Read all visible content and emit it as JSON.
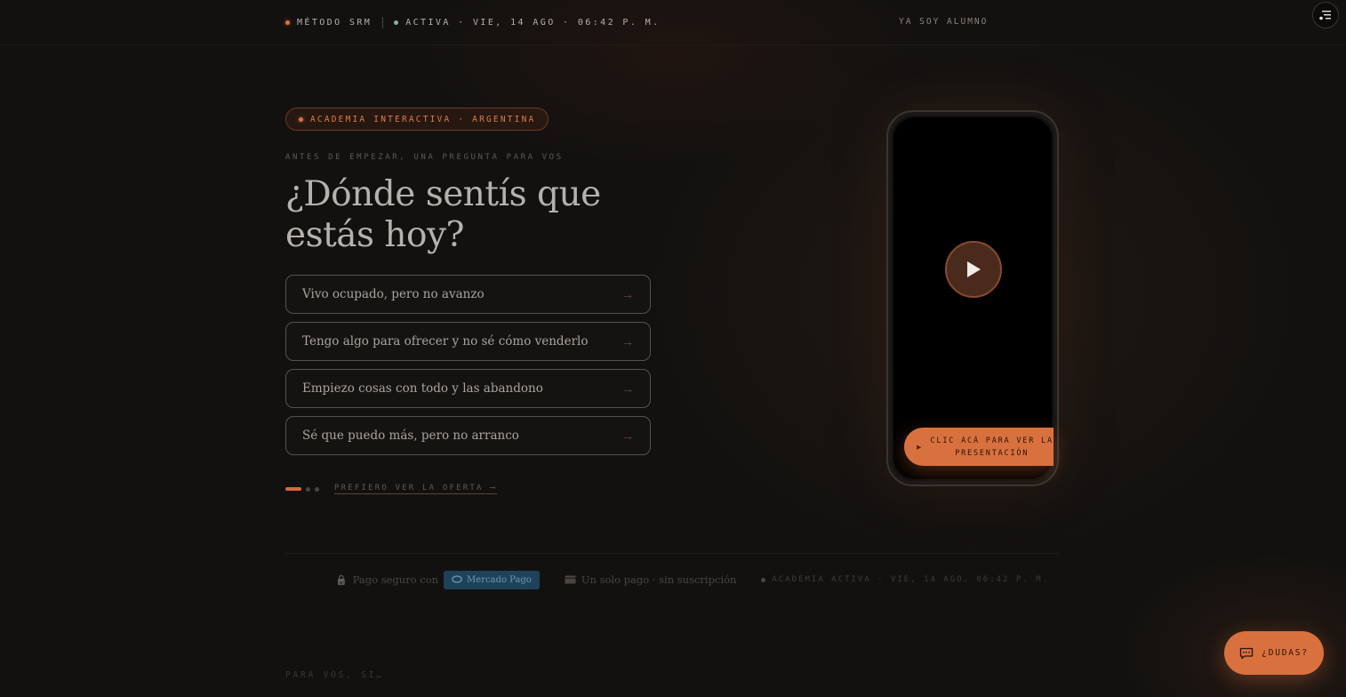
{
  "topbar": {
    "brand": "MÉTODO SRM",
    "status": "ACTIVA · VIE, 14 AGO · 06:42 P. M.",
    "login_link": "YA SOY ALUMNO"
  },
  "hero": {
    "badge": "ACADEMIA INTERACTIVA · ARGENTINA",
    "eyebrow": "ANTES DE EMPEZAR, UNA PREGUNTA PARA VOS",
    "headline": "¿Dónde sentís que estás hoy?",
    "options": [
      {
        "label": "Vivo ocupado, pero no avanzo",
        "arrow": "→"
      },
      {
        "label": "Tengo algo para ofrecer y no sé cómo venderlo",
        "arrow": "→"
      },
      {
        "label": "Empiezo cosas con todo y las abandono",
        "arrow": "→"
      },
      {
        "label": "Sé que puedo más, pero no arranco",
        "arrow": "→"
      }
    ],
    "progress": {
      "current_step": 1,
      "total_steps": 3
    },
    "offer_link": "PREFIERO VER LA OFERTA ⟶"
  },
  "video": {
    "play_icon": "play-icon",
    "present_icon": "▶",
    "present_label": "CLIC ACÁ PARA VER LA PRESENTACIÓN"
  },
  "trust": {
    "secure_icon": "🔒",
    "secure_text": "Pago seguro con",
    "provider": "Mercado Pago",
    "card_icon": "card-icon",
    "single_payment": "Un solo pago · sin suscripción",
    "status": "ACADEMIA ACTIVA · VIE, 14 AGO, 06:42 P. M."
  },
  "section": {
    "for_you": "PARA VOS, SI…"
  },
  "chat": {
    "label": "¿DUDAS?"
  },
  "colors": {
    "accent": "#d9713f",
    "background": "#131110",
    "status_green": "#7fb59a",
    "mercado_pago": "#1e4258"
  }
}
